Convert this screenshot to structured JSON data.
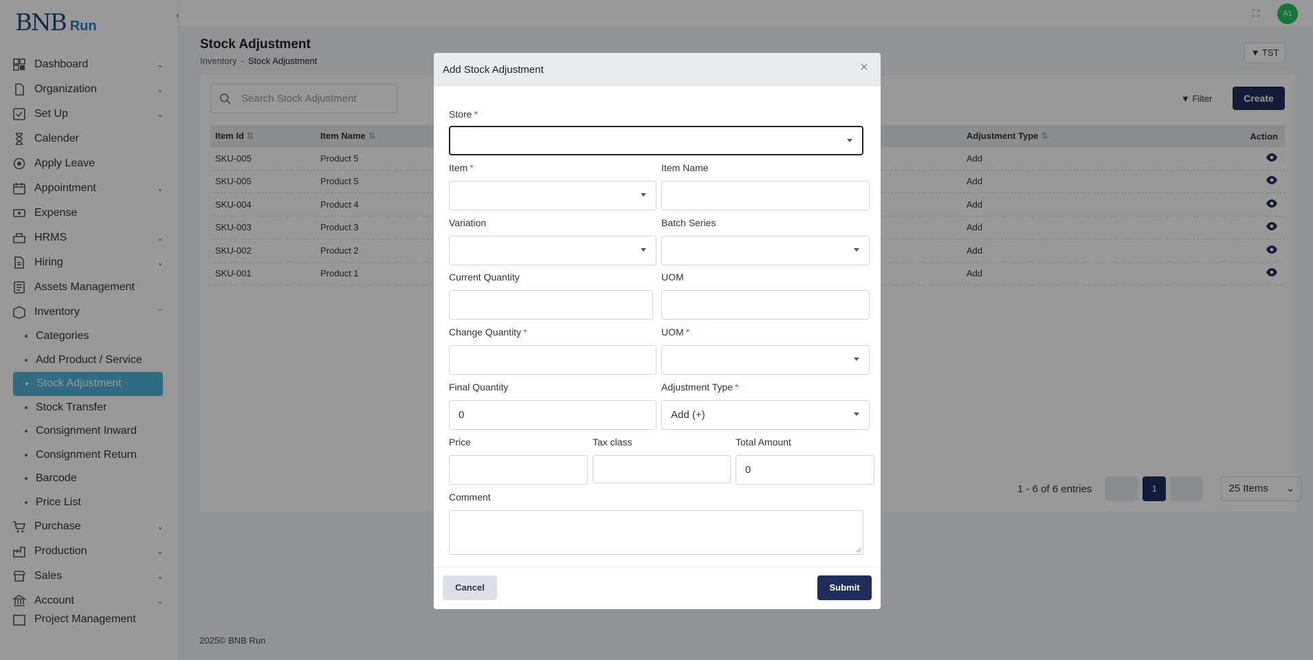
{
  "app": {
    "logo_mark": "BNB",
    "logo_run": "Run",
    "avatar_initials": "A1"
  },
  "sidebar": {
    "items": [
      {
        "label": "Dashboard",
        "icon": "dashboard-icon",
        "expandable": true
      },
      {
        "label": "Organization",
        "icon": "organization-icon",
        "expandable": true
      },
      {
        "label": "Set Up",
        "icon": "setup-icon",
        "expandable": true
      },
      {
        "label": "Calender",
        "icon": "hourglass-icon",
        "expandable": false
      },
      {
        "label": "Apply Leave",
        "icon": "leave-icon",
        "expandable": false
      },
      {
        "label": "Appointment",
        "icon": "calendar-icon",
        "expandable": true
      },
      {
        "label": "Expense",
        "icon": "expense-icon",
        "expandable": false
      },
      {
        "label": "HRMS",
        "icon": "hrms-icon",
        "expandable": true
      },
      {
        "label": "Hiring",
        "icon": "hiring-icon",
        "expandable": true
      },
      {
        "label": "Assets Management",
        "icon": "assets-icon",
        "expandable": false
      },
      {
        "label": "Inventory",
        "icon": "inventory-icon",
        "expandable": true,
        "expanded": true
      }
    ],
    "inventory_sub": [
      {
        "label": "Categories"
      },
      {
        "label": "Add Product / Service"
      },
      {
        "label": "Stock Adjustment",
        "active": true
      },
      {
        "label": "Stock Transfer"
      },
      {
        "label": "Consignment Inward"
      },
      {
        "label": "Consignment Return"
      },
      {
        "label": "Barcode"
      },
      {
        "label": "Price List"
      }
    ],
    "items_after": [
      {
        "label": "Purchase",
        "icon": "cart-icon",
        "expandable": true
      },
      {
        "label": "Production",
        "icon": "production-icon",
        "expandable": true
      },
      {
        "label": "Sales",
        "icon": "sales-icon",
        "expandable": true
      },
      {
        "label": "Account",
        "icon": "bank-icon",
        "expandable": true
      },
      {
        "label": "Project Management",
        "icon": "project-icon",
        "expandable": true
      }
    ]
  },
  "page": {
    "title": "Stock Adjustment",
    "breadcrumb_parent": "Inventory",
    "breadcrumb_sep": "-",
    "breadcrumb_current": "Stock Adjustment",
    "tst_label": "TST",
    "search_placeholder": "Search Stock Adjustment",
    "filter_label": "Filter",
    "create_label": "Create"
  },
  "table": {
    "headers": {
      "id": "Item Id",
      "name": "Item Name",
      "type": "Adjustment Type",
      "action": "Action"
    },
    "rows": [
      {
        "id": "SKU-005",
        "name": "Product 5",
        "type": "Add"
      },
      {
        "id": "SKU-005",
        "name": "Product 5",
        "type": "Add"
      },
      {
        "id": "SKU-004",
        "name": "Product 4",
        "type": "Add"
      },
      {
        "id": "SKU-003",
        "name": "Product 3",
        "type": "Add"
      },
      {
        "id": "SKU-002",
        "name": "Product 2",
        "type": "Add"
      },
      {
        "id": "SKU-001",
        "name": "Product 1",
        "type": "Add"
      }
    ]
  },
  "pagination": {
    "entries": "1 - 6 of 6 entries",
    "current_page": "1",
    "items_per_page": "25 Items"
  },
  "footer": {
    "text": "2025© BNB Run"
  },
  "modal": {
    "title": "Add Stock Adjustment",
    "fields": {
      "store": {
        "label": "Store",
        "value": ""
      },
      "item": {
        "label": "Item",
        "value": ""
      },
      "item_name": {
        "label": "Item Name",
        "value": ""
      },
      "variation": {
        "label": "Variation",
        "value": ""
      },
      "batch_series": {
        "label": "Batch Series",
        "value": ""
      },
      "current_quantity": {
        "label": "Current Quantity",
        "value": ""
      },
      "uom_current": {
        "label": "UOM",
        "value": ""
      },
      "change_quantity": {
        "label": "Change Quantity",
        "value": ""
      },
      "uom_change": {
        "label": "UOM",
        "value": ""
      },
      "final_quantity": {
        "label": "Final Quantity",
        "value": "0"
      },
      "adjustment_type": {
        "label": "Adjustment Type",
        "value": "Add (+)"
      },
      "price": {
        "label": "Price",
        "value": ""
      },
      "tax_class": {
        "label": "Tax class",
        "value": ""
      },
      "total_amount": {
        "label": "Total Amount",
        "value": "0"
      },
      "comment": {
        "label": "Comment",
        "value": ""
      }
    },
    "required_marker": "*",
    "cancel_label": "Cancel",
    "submit_label": "Submit"
  }
}
